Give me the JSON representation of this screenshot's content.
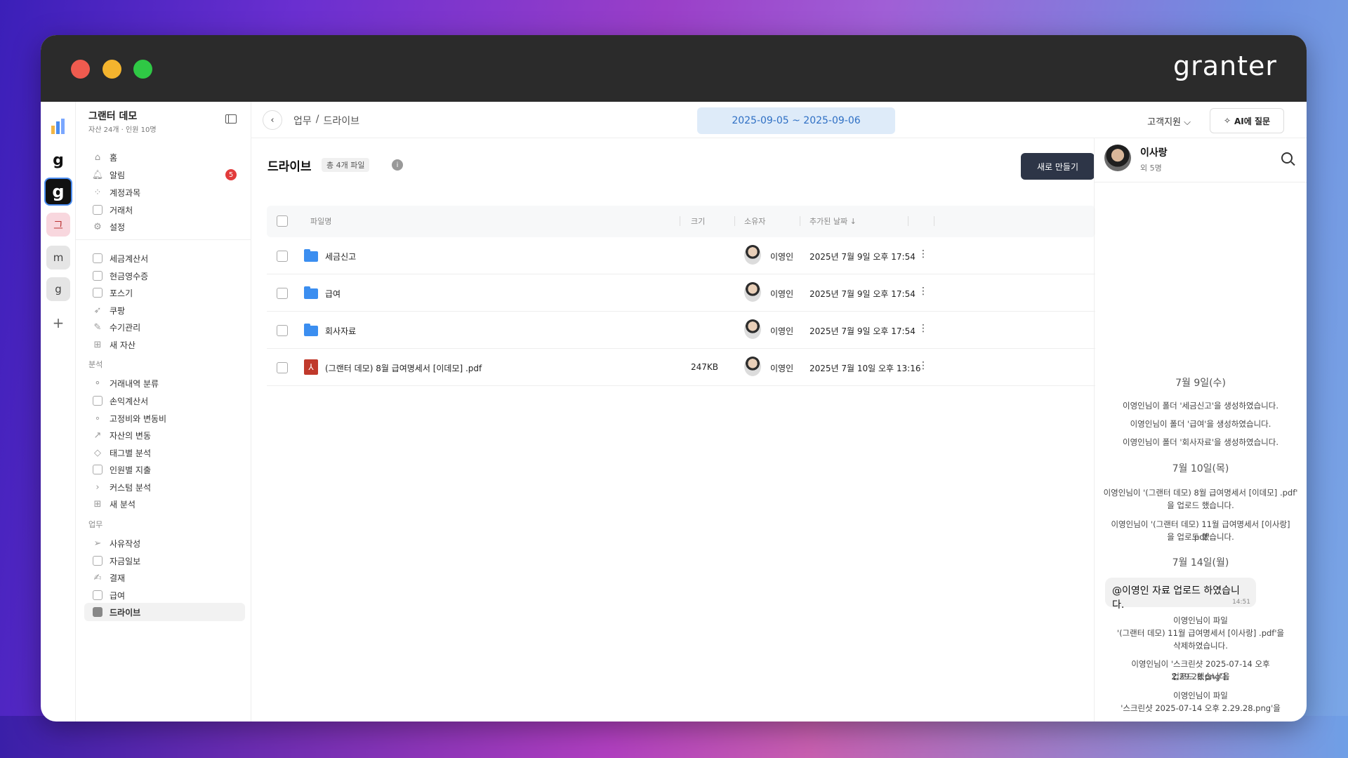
{
  "brand": "granter",
  "rail": {
    "g1": "g",
    "g2": "g",
    "ko": "그",
    "m": "m",
    "gg": "g",
    "plus": "+"
  },
  "org": {
    "name": "그랜터 데모",
    "sub": "자산 24개 · 인원 10명"
  },
  "nav_top": [
    {
      "label": "홈",
      "icon": "home-icon"
    },
    {
      "label": "알림",
      "icon": "bell-icon",
      "badge": "5"
    },
    {
      "label": "계정과목",
      "icon": "grid-icon"
    },
    {
      "label": "거래처",
      "icon": "contact-icon"
    },
    {
      "label": "설정",
      "icon": "gear-icon"
    }
  ],
  "nav_assets": [
    {
      "label": "세금계산서",
      "icon": "invoice-icon"
    },
    {
      "label": "현금영수증",
      "icon": "receipt-icon"
    },
    {
      "label": "포스기",
      "icon": "pos-icon"
    },
    {
      "label": "쿠팡",
      "icon": "rocket-icon"
    },
    {
      "label": "수기관리",
      "icon": "pencil-icon"
    },
    {
      "label": "새 자산",
      "icon": "plus-icon"
    }
  ],
  "section_analysis": "분석",
  "nav_analysis": [
    {
      "label": "거래내역 분류",
      "icon": "classify-icon"
    },
    {
      "label": "손익계산서",
      "icon": "statement-icon"
    },
    {
      "label": "고정비와 변동비",
      "icon": "cost-icon"
    },
    {
      "label": "자산의 변동",
      "icon": "trend-icon"
    },
    {
      "label": "태그별 분석",
      "icon": "tag-icon"
    },
    {
      "label": "인원별 지출",
      "icon": "person-icon"
    },
    {
      "label": "커스텀 분석",
      "icon": "chevron-right-icon"
    },
    {
      "label": "새 분석",
      "icon": "plus-icon"
    }
  ],
  "section_work": "업무",
  "nav_work": [
    {
      "label": "사유작성",
      "icon": "send-icon"
    },
    {
      "label": "자금일보",
      "icon": "report-icon"
    },
    {
      "label": "결재",
      "icon": "sign-icon"
    },
    {
      "label": "급여",
      "icon": "payroll-icon"
    },
    {
      "label": "드라이브",
      "icon": "drive-icon",
      "active": true
    }
  ],
  "breadcrumb": {
    "part1": "업무",
    "sep": "/",
    "part2": "드라이브"
  },
  "date_range": "2025-09-05 ~ 2025-09-06",
  "support": "고객지원 ⌵",
  "ai_button": "AI에 질문",
  "drive": {
    "title": "드라이브",
    "count": "총 4개 파일",
    "new_button": "새로 만들기"
  },
  "table": {
    "headers": {
      "name": "파일명",
      "size": "크기",
      "owner": "소유자",
      "date": "추가된 날짜 ↓"
    },
    "rows": [
      {
        "type": "folder",
        "name": "세금신고",
        "size": "",
        "owner": "이영인",
        "date": "2025년 7월 9일 오후 17:54"
      },
      {
        "type": "folder",
        "name": "급여",
        "size": "",
        "owner": "이영인",
        "date": "2025년 7월 9일 오후 17:54"
      },
      {
        "type": "folder",
        "name": "회사자료",
        "size": "",
        "owner": "이영인",
        "date": "2025년 7월 9일 오후 17:54"
      },
      {
        "type": "pdf",
        "name": "(그랜터 데모) 8월 급여명세서 [이데모] .pdf",
        "size": "247KB",
        "owner": "이영인",
        "date": "2025년 7월 10일 오후 13:16"
      }
    ]
  },
  "panel": {
    "name": "이사랑",
    "sub": "외 5명",
    "day1": "7월 9일(수)",
    "log1": "이영인님이 폴더 '세금신고'을 생성하였습니다.",
    "log2": "이영인님이 폴더 '급여'을 생성하였습니다.",
    "log3": "이영인님이 폴더 '회사자료'을 생성하였습니다.",
    "day2": "7월 10일(목)",
    "log4a": "이영인님이 '(그랜터 데모) 8월 급여명세서 [이데모] .pdf'",
    "log4b": "을 업로드 했습니다.",
    "log5a": "이영인님이 '(그랜터 데모) 11월 급여명세서 [이사랑] .pdf'",
    "log5b": "을 업로드 했습니다.",
    "day3": "7월 14일(월)",
    "bubble": "@이영인 자료 업로드 하였습니다.",
    "bubble_time": "14:51",
    "log6a": "이영인님이 파일",
    "log6b": "'(그랜터 데모) 11월 급여명세서 [이사랑] .pdf'을",
    "log6c": "삭제하였습니다.",
    "log7a": "이영인님이 '스크린샷 2025-07-14 오후 2.29.28.png'을",
    "log7b": "업로드 했습니다.",
    "log8a": "이영인님이 파일",
    "log8b": "'스크린샷 2025-07-14 오후 2.29.28.png'을"
  }
}
